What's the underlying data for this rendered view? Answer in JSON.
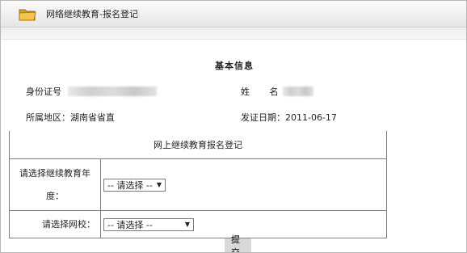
{
  "header": {
    "title": "网络继续教育-报名登记",
    "icon": "folder-icon"
  },
  "basic_info": {
    "section_title": "基本信息",
    "id_label": "身份证号",
    "name_label": "姓      名：",
    "region_label": "所属地区：",
    "region_value": "湖南省省直",
    "issue_date_label": "发证日期：",
    "issue_date_value": "2011-06-17"
  },
  "form": {
    "title": "网上继续教育报名登记",
    "year_label": "请选择继续教育年度：",
    "year_select": "-- 请选择 --",
    "school_label": "请选择网校：",
    "school_select": "-- 请选择 --"
  },
  "actions": {
    "submit_label": "提交"
  },
  "colors": {
    "border": "#7f7f7f",
    "header_bg": "#eeeeee",
    "button_bg": "#d9d9d9"
  }
}
